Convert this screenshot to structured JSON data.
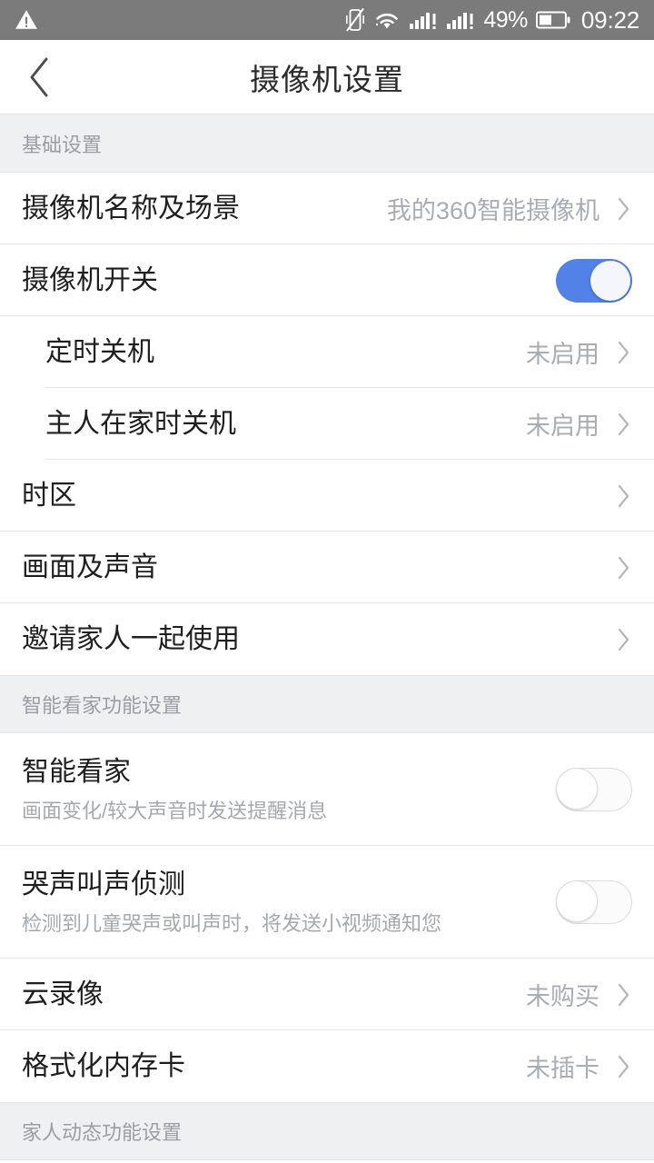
{
  "statusbar": {
    "warning_icon": "warning-triangle-icon",
    "vibrate_icon": "vibrate-off-icon",
    "wifi_icon": "wifi-icon",
    "signal1_icon": "signal-bars-alert-icon",
    "signal2_icon": "signal-bars-alert-icon",
    "battery_percent": "49%",
    "battery_icon": "battery-icon",
    "time": "09:22"
  },
  "titlebar": {
    "back_icon": "chevron-left-icon",
    "title": "摄像机设置"
  },
  "sections": [
    {
      "header": "基础设置",
      "rows": [
        {
          "label": "摄像机名称及场景",
          "value": "我的360智能摄像机",
          "type": "link"
        },
        {
          "label": "摄像机开关",
          "type": "toggle",
          "toggle_on": true
        },
        {
          "label": "定时关机",
          "value": "未启用",
          "type": "link",
          "indent": true
        },
        {
          "label": "主人在家时关机",
          "value": "未启用",
          "type": "link",
          "indent": true
        },
        {
          "label": "时区",
          "value": "",
          "type": "link"
        },
        {
          "label": "画面及声音",
          "value": "",
          "type": "link"
        },
        {
          "label": "邀请家人一起使用",
          "value": "",
          "type": "link"
        }
      ]
    },
    {
      "header": "智能看家功能设置",
      "rows": [
        {
          "label": "智能看家",
          "sub": "画面变化/较大声音时发送提醒消息",
          "type": "toggle",
          "toggle_on": false
        },
        {
          "label": "哭声叫声侦测",
          "sub": "检测到儿童哭声或叫声时，将发送小视频通知您",
          "type": "toggle",
          "toggle_on": false
        },
        {
          "label": "云录像",
          "value": "未购买",
          "type": "link"
        },
        {
          "label": "格式化内存卡",
          "value": "未插卡",
          "type": "link"
        }
      ]
    },
    {
      "header": "家人动态功能设置",
      "rows": []
    }
  ],
  "colors": {
    "statusbar_bg": "#7b7b7b",
    "accent_toggle_on": "#5281e8",
    "section_header_bg": "#eff0f2",
    "section_header_text": "#9a9ea3",
    "row_label": "#1f1f1f",
    "row_value": "#a9acb0",
    "divider": "#e6e6e6"
  }
}
